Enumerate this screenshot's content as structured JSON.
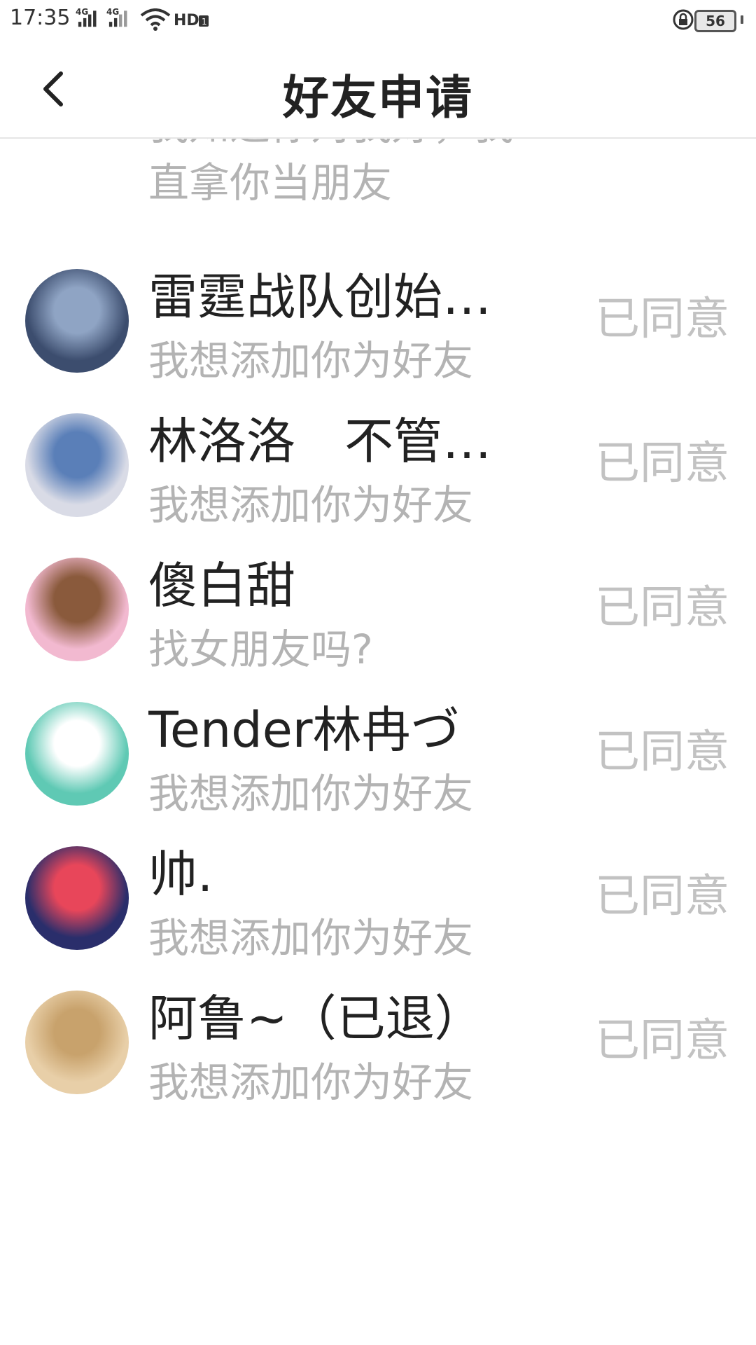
{
  "status_bar": {
    "time": "17:35",
    "network_1": "4G",
    "network_2": "4G",
    "battery": "56"
  },
  "header": {
    "title": "好友申请"
  },
  "partial_row": {
    "message_line1": "我知道你对我好，我",
    "message_line2": "直拿你当朋友"
  },
  "requests": [
    {
      "name": "雷霆战队创始人…",
      "message": "我想添加你为好友",
      "status": "已同意",
      "avatar_colors": [
        "#3c4d6e",
        "#8fa4c4"
      ]
    },
    {
      "name": "林洛洛　不管他…",
      "message": "我想添加你为好友",
      "status": "已同意",
      "avatar_colors": [
        "#d9dbe6",
        "#5a7fb8"
      ]
    },
    {
      "name": "傻白甜",
      "message": "找女朋友吗?",
      "status": "已同意",
      "avatar_colors": [
        "#f2b9d0",
        "#8a5a3c"
      ]
    },
    {
      "name": "Tender林冉づ",
      "message": "我想添加你为好友",
      "status": "已同意",
      "avatar_colors": [
        "#5fc9b4",
        "#ffffff"
      ]
    },
    {
      "name": "帅.",
      "message": "我想添加你为好友",
      "status": "已同意",
      "avatar_colors": [
        "#2a2e6b",
        "#e8465a"
      ]
    },
    {
      "name": "阿鲁~（已退）",
      "message": "我想添加你为好友",
      "status": "已同意",
      "avatar_colors": [
        "#e8cfa8",
        "#c8a26c"
      ]
    }
  ],
  "colors": {
    "name": "#222222",
    "message": "#b3b3b3",
    "status": "#c2c2c2",
    "divider": "#e6e6e6"
  }
}
